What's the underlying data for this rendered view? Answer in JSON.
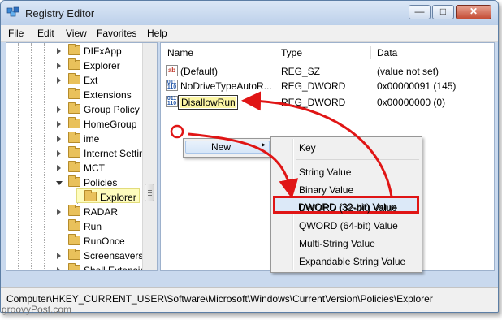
{
  "window": {
    "title": "Registry Editor",
    "controls": {
      "minimize": "—",
      "maximize": "□",
      "close": "✕"
    }
  },
  "menu": [
    "File",
    "Edit",
    "View",
    "Favorites",
    "Help"
  ],
  "tree": {
    "items": [
      {
        "label": "DIFxApp"
      },
      {
        "label": "Explorer"
      },
      {
        "label": "Ext"
      },
      {
        "label": "Extensions"
      },
      {
        "label": "Group Policy"
      },
      {
        "label": "HomeGroup"
      },
      {
        "label": "ime"
      },
      {
        "label": "Internet Settin"
      },
      {
        "label": "MCT"
      },
      {
        "label": "Policies"
      },
      {
        "label": "Explorer"
      },
      {
        "label": "RADAR"
      },
      {
        "label": "Run"
      },
      {
        "label": "RunOnce"
      },
      {
        "label": "Screensavers"
      },
      {
        "label": "Shell Extensio"
      }
    ]
  },
  "list": {
    "columns": [
      "Name",
      "Type",
      "Data"
    ],
    "rows": [
      {
        "name": "(Default)",
        "type": "REG_SZ",
        "data": "(value not set)",
        "icon": "string-value-icon"
      },
      {
        "name": "NoDriveTypeAutoR...",
        "type": "REG_DWORD",
        "data": "0x00000091 (145)",
        "icon": "binary-value-icon"
      },
      {
        "name": "DisallowRun",
        "type": "REG_DWORD",
        "data": "0x00000000 (0)",
        "icon": "binary-value-icon"
      }
    ]
  },
  "context_menu": {
    "new_label": "New",
    "submenu": [
      "Key",
      "String Value",
      "Binary Value",
      "DWORD (32-bit) Value",
      "QWORD (64-bit) Value",
      "Multi-String Value",
      "Expandable String Value"
    ]
  },
  "statusbar": {
    "path": "Computer\\HKEY_CURRENT_USER\\Software\\Microsoft\\Windows\\CurrentVersion\\Policies\\Explorer"
  },
  "watermark": "groovyPost.com",
  "colors": {
    "annotation": "#e01515",
    "selection": "#fefcbd"
  }
}
